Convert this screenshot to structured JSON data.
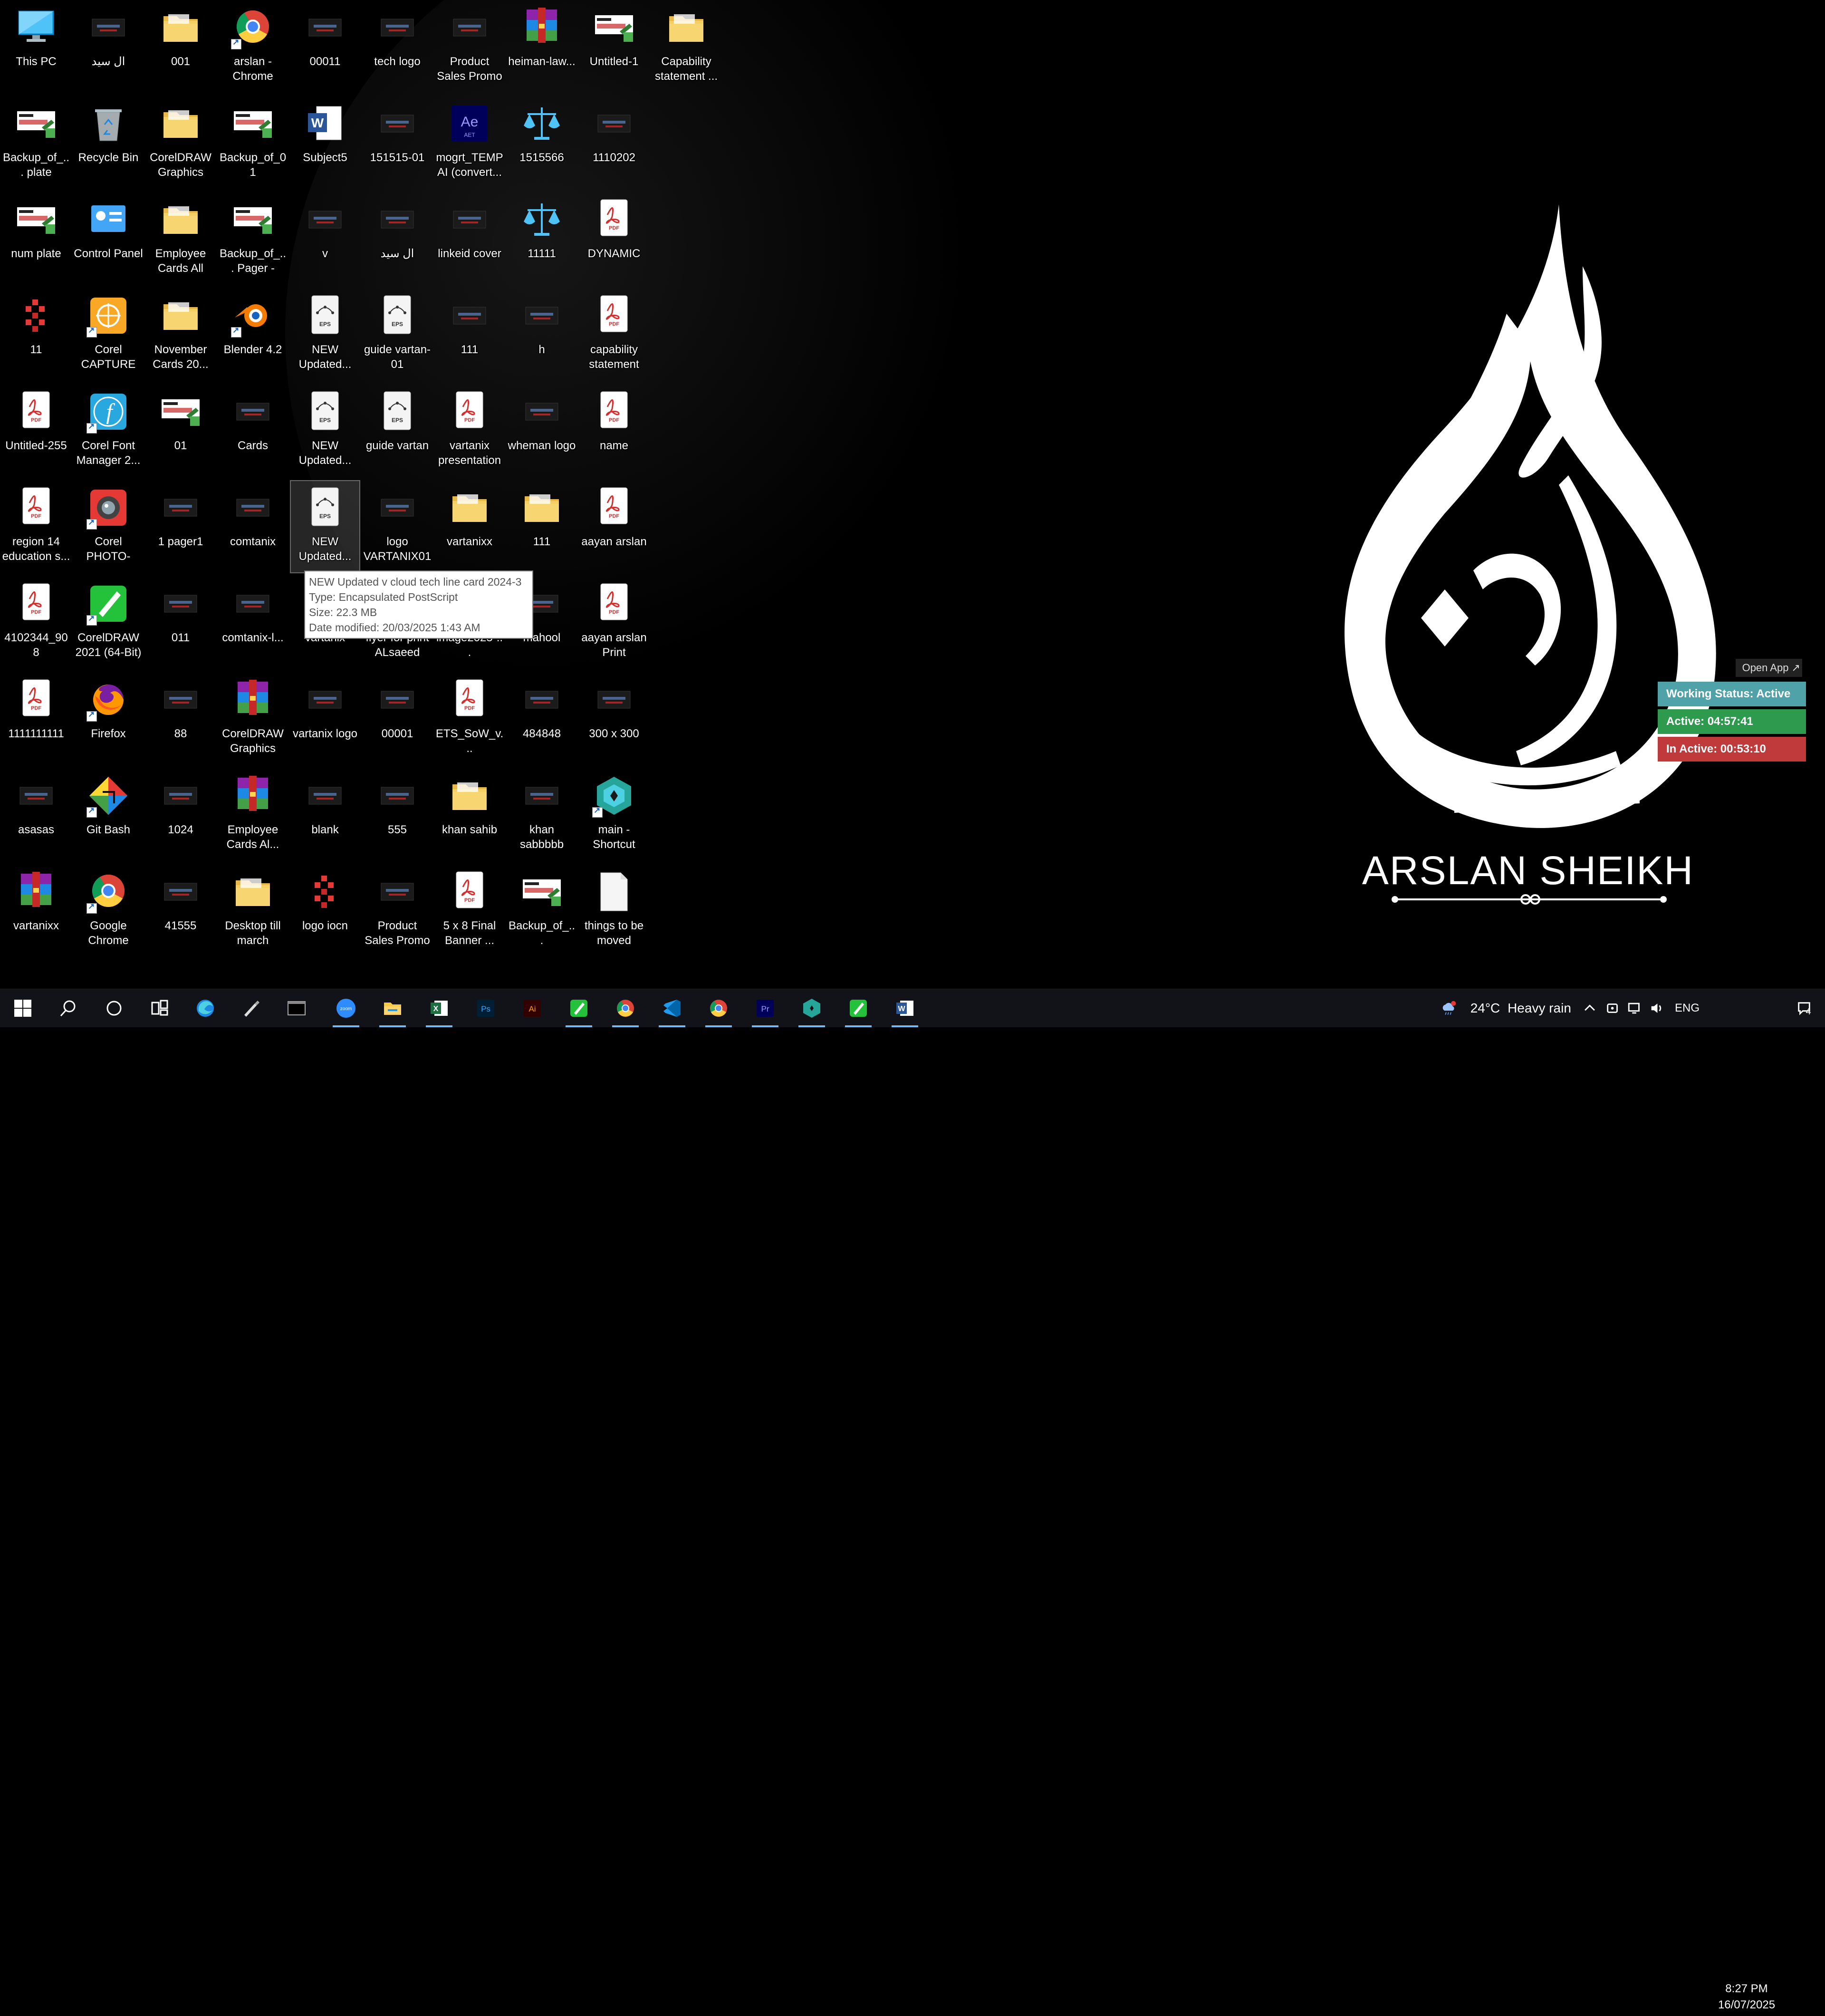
{
  "wallpaper": {
    "brand": "ARSLAN SHEIKH",
    "logo": "arslan-calligraphy-logo"
  },
  "desktop_icons": [
    {
      "label": "This PC",
      "icon": "this-pc-icon"
    },
    {
      "label": "ال سيد",
      "icon": "image-thumb-icon"
    },
    {
      "label": "001",
      "icon": "folder-icon"
    },
    {
      "label": "arslan - Chrome",
      "icon": "chrome-icon"
    },
    {
      "label": "00011",
      "icon": "image-thumb-icon"
    },
    {
      "label": "tech logo",
      "icon": "image-thumb-icon"
    },
    {
      "label": "Product Sales Promo Pack...",
      "icon": "image-thumb-icon"
    },
    {
      "label": "heiman-law...",
      "icon": "winrar-icon"
    },
    {
      "label": "Untitled-1",
      "icon": "coreldraw-file-icon"
    },
    {
      "label": "Capability statement ...",
      "icon": "folder-icon"
    },
    {
      "label": "Backup_of_... plate",
      "icon": "coreldraw-file-icon"
    },
    {
      "label": "Recycle Bin",
      "icon": "recycle-bin-icon"
    },
    {
      "label": "CorelDRAW Graphics Su...",
      "icon": "folder-icon"
    },
    {
      "label": "Backup_of_01",
      "icon": "coreldraw-file-icon"
    },
    {
      "label": "Subject5",
      "icon": "word-icon"
    },
    {
      "label": "151515-01",
      "icon": "image-thumb-icon"
    },
    {
      "label": "mogrt_TEMP AI (convert...",
      "icon": "after-effects-icon"
    },
    {
      "label": "1515566",
      "icon": "scales-icon"
    },
    {
      "label": "1110202",
      "icon": "image-thumb-icon"
    },
    {
      "label": "num plate",
      "icon": "coreldraw-file-icon"
    },
    {
      "label": "Control Panel",
      "icon": "control-panel-icon"
    },
    {
      "label": "Employee Cards All",
      "icon": "folder-icon"
    },
    {
      "label": "Backup_of_... Pager - NY...",
      "icon": "coreldraw-file-icon"
    },
    {
      "label": "v",
      "icon": "image-thumb-icon"
    },
    {
      "label": "ال سيد",
      "icon": "image-thumb-icon"
    },
    {
      "label": "linkeid cover",
      "icon": "image-thumb-icon"
    },
    {
      "label": "11111",
      "icon": "scales-icon"
    },
    {
      "label": "DYNAMIC",
      "icon": "pdf-icon"
    },
    {
      "label": "11",
      "icon": "logo-red-icon"
    },
    {
      "label": "Corel CAPTURE 2...",
      "icon": "corel-capture-icon"
    },
    {
      "label": "November Cards 20...",
      "icon": "folder-icon"
    },
    {
      "label": "Blender 4.2",
      "icon": "blender-icon"
    },
    {
      "label": "NEW Updated...",
      "icon": "eps-icon"
    },
    {
      "label": "guide vartan-01",
      "icon": "eps-icon"
    },
    {
      "label": "111",
      "icon": "image-thumb-icon"
    },
    {
      "label": "h",
      "icon": "image-thumb-icon"
    },
    {
      "label": "capability statement",
      "icon": "pdf-icon"
    },
    {
      "label": "Untitled-255",
      "icon": "pdf-icon"
    },
    {
      "label": "Corel Font Manager 2...",
      "icon": "corel-font-manager-icon"
    },
    {
      "label": "01",
      "icon": "coreldraw-file-icon"
    },
    {
      "label": "Cards",
      "icon": "image-thumb-icon"
    },
    {
      "label": "NEW Updated...",
      "icon": "eps-icon"
    },
    {
      "label": "guide vartan",
      "icon": "eps-icon"
    },
    {
      "label": "vartanix presentation",
      "icon": "pdf-icon"
    },
    {
      "label": "wheman logo",
      "icon": "image-thumb-icon"
    },
    {
      "label": "name",
      "icon": "pdf-icon"
    },
    {
      "label": "region 14 education s...",
      "icon": "pdf-icon"
    },
    {
      "label": "Corel PHOTO-PAI...",
      "icon": "corel-photo-paint-icon"
    },
    {
      "label": "1 pager1",
      "icon": "image-thumb-icon"
    },
    {
      "label": "comtanix",
      "icon": "image-thumb-icon"
    },
    {
      "label": "NEW Updated...",
      "icon": "eps-icon"
    },
    {
      "label": "logo VARTANIX01",
      "icon": "image-thumb-icon"
    },
    {
      "label": "vartanixx",
      "icon": "folder-icon"
    },
    {
      "label": "111",
      "icon": "folder-icon"
    },
    {
      "label": "aayan arslan",
      "icon": "pdf-icon"
    },
    {
      "label": "4102344_908",
      "icon": "pdf-icon"
    },
    {
      "label": "CorelDRAW 2021 (64-Bit)",
      "icon": "coreldraw-app-icon"
    },
    {
      "label": "011",
      "icon": "image-thumb-icon"
    },
    {
      "label": "comtanix-l...",
      "icon": "image-thumb-icon"
    },
    {
      "label": "vartanix",
      "icon": "image-thumb-icon"
    },
    {
      "label": "flyer for print ALsaeed po...",
      "icon": "image-thumb-icon"
    },
    {
      "label": "image2025-...",
      "icon": "image-thumb-icon"
    },
    {
      "label": "mahool",
      "icon": "image-thumb-icon"
    },
    {
      "label": "aayan arslan Print",
      "icon": "pdf-icon"
    },
    {
      "label": "1111111111",
      "icon": "pdf-icon"
    },
    {
      "label": "Firefox",
      "icon": "firefox-icon"
    },
    {
      "label": "88",
      "icon": "image-thumb-icon"
    },
    {
      "label": "CorelDRAW Graphics Su...",
      "icon": "winrar-icon"
    },
    {
      "label": "vartanix logo",
      "icon": "image-thumb-icon"
    },
    {
      "label": "00001",
      "icon": "image-thumb-icon"
    },
    {
      "label": "ETS_SoW_v...",
      "icon": "pdf-icon"
    },
    {
      "label": "484848",
      "icon": "image-thumb-icon"
    },
    {
      "label": "300 x 300",
      "icon": "image-thumb-icon"
    },
    {
      "label": "asasas",
      "icon": "image-thumb-icon"
    },
    {
      "label": "Git Bash",
      "icon": "git-bash-icon"
    },
    {
      "label": "1024",
      "icon": "image-thumb-icon"
    },
    {
      "label": "Employee Cards Al...",
      "icon": "winrar-icon"
    },
    {
      "label": "blank",
      "icon": "image-thumb-icon"
    },
    {
      "label": "555",
      "icon": "image-thumb-icon"
    },
    {
      "label": "khan sahib",
      "icon": "folder-icon"
    },
    {
      "label": "khan sabbbbb",
      "icon": "image-thumb-icon"
    },
    {
      "label": "main - Shortcut",
      "icon": "app-shortcut-icon"
    },
    {
      "label": "vartanixx",
      "icon": "winrar-icon"
    },
    {
      "label": "Google Chrome",
      "icon": "chrome-icon"
    },
    {
      "label": "41555",
      "icon": "image-thumb-icon"
    },
    {
      "label": "Desktop till march",
      "icon": "folder-icon"
    },
    {
      "label": "logo iocn",
      "icon": "logo-red-icon"
    },
    {
      "label": "Product Sales Promo Pack...",
      "icon": "image-thumb-icon"
    },
    {
      "label": "5 x 8 Final Banner ...",
      "icon": "pdf-icon"
    },
    {
      "label": "Backup_of_...",
      "icon": "coreldraw-file-icon"
    },
    {
      "label": "things to be moved",
      "icon": "blank-file-icon"
    }
  ],
  "tooltip": {
    "name": "NEW Updated v cloud tech line card 2024-3",
    "type": "Type: Encapsulated PostScript",
    "size": "Size: 22.3 MB",
    "modified": "Date modified: 20/03/2025 1:43 AM"
  },
  "tracker": {
    "open_app_label": "Open App ↗",
    "working_status": "Working Status: Active",
    "active": "Active: 04:57:41",
    "inactive": "In Active: 00:53:10",
    "colors": {
      "status": "#4fa3a8",
      "active": "#2e9a4e",
      "inactive": "#c0393b"
    }
  },
  "taskbar": {
    "items": [
      {
        "name": "start",
        "icon": "windows-start-icon"
      },
      {
        "name": "search",
        "icon": "search-icon"
      },
      {
        "name": "cortana",
        "icon": "cortana-circle-icon"
      },
      {
        "name": "task-view",
        "icon": "task-view-icon"
      },
      {
        "name": "edge",
        "icon": "edge-icon"
      },
      {
        "name": "pen",
        "icon": "pen-icon"
      },
      {
        "name": "terminal",
        "icon": "terminal-icon"
      },
      {
        "name": "zoom",
        "icon": "zoom-icon"
      },
      {
        "name": "file-explorer",
        "icon": "file-explorer-icon"
      },
      {
        "name": "excel",
        "icon": "excel-icon"
      },
      {
        "name": "photoshop",
        "icon": "photoshop-icon"
      },
      {
        "name": "illustrator",
        "icon": "illustrator-icon"
      },
      {
        "name": "coreldraw",
        "icon": "coreldraw-app-icon"
      },
      {
        "name": "chrome",
        "icon": "chrome-icon"
      },
      {
        "name": "vscode",
        "icon": "vscode-icon"
      },
      {
        "name": "chrome-profile",
        "icon": "chrome-icon"
      },
      {
        "name": "premiere",
        "icon": "premiere-icon"
      },
      {
        "name": "app",
        "icon": "app-shortcut-icon"
      },
      {
        "name": "coreldraw-2",
        "icon": "coreldraw-app-icon"
      },
      {
        "name": "word",
        "icon": "word-icon"
      }
    ],
    "weather": {
      "temp": "24°C",
      "desc": "Heavy rain",
      "badge": "1"
    },
    "language": "ENG",
    "time": "8:27 PM",
    "date": "16/07/2025",
    "notifications": "4"
  }
}
